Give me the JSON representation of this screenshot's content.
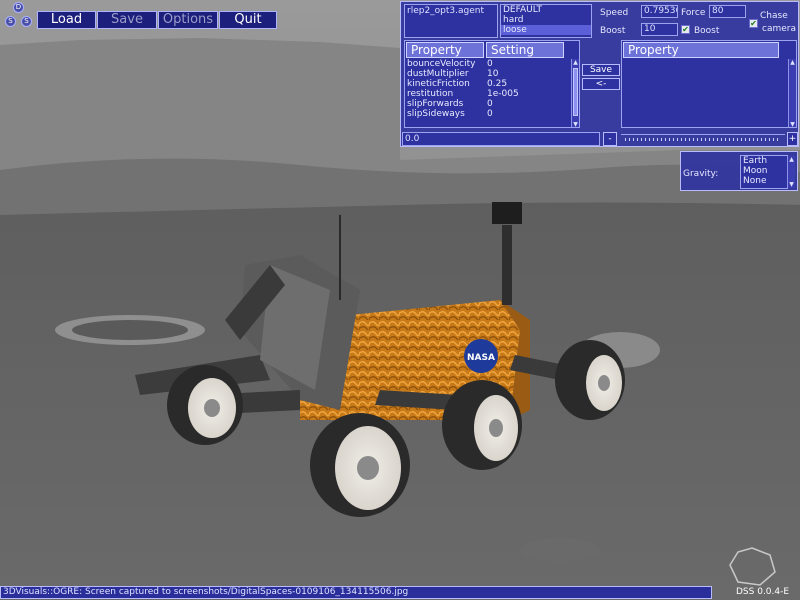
{
  "logo": {
    "letters": [
      "D",
      "S",
      "S"
    ]
  },
  "menu": {
    "load": "Load",
    "save": "Save",
    "options": "Options",
    "quit": "Quit"
  },
  "agent": {
    "file": "rlep2_opt3.agent",
    "presets": [
      "DEFAULT",
      "hard",
      "loose"
    ],
    "selected_preset": "loose"
  },
  "controls": {
    "speed_label": "Speed",
    "speed_value": "0.79536",
    "force_label": "Force",
    "force_value": "80",
    "boost_label": "Boost",
    "boost_value": "10",
    "boost_check_label": "Boost",
    "chase_label": "Chase",
    "camera_label": "camera"
  },
  "properties": {
    "header_property": "Property",
    "header_setting": "Setting",
    "rows": [
      {
        "name": "bounceVelocity",
        "value": "0"
      },
      {
        "name": "dustMultiplier",
        "value": "10"
      },
      {
        "name": "kineticFriction",
        "value": "0.25"
      },
      {
        "name": "restitution",
        "value": "1e-005"
      },
      {
        "name": "slipForwards",
        "value": "0"
      },
      {
        "name": "slipSideways",
        "value": "0"
      }
    ],
    "edit_value": "0.0",
    "minus_label": "-"
  },
  "transfer": {
    "save_label": "Save",
    "back_label": "<-"
  },
  "right_list": {
    "header": "Property"
  },
  "gravity": {
    "label": "Gravity:",
    "options": [
      "Earth",
      "Moon",
      "None"
    ]
  },
  "status": {
    "message": "3DVisuals::OGRE: Screen captured to screenshots/DigitalSpaces-0109106_134115506.jpg"
  },
  "version": "DSS 0.0.4-E",
  "colors": {
    "panel": "#3034a0",
    "panel_border": "#b8bcff",
    "button": "#1c1f7c",
    "selection": "#5b60d8"
  }
}
